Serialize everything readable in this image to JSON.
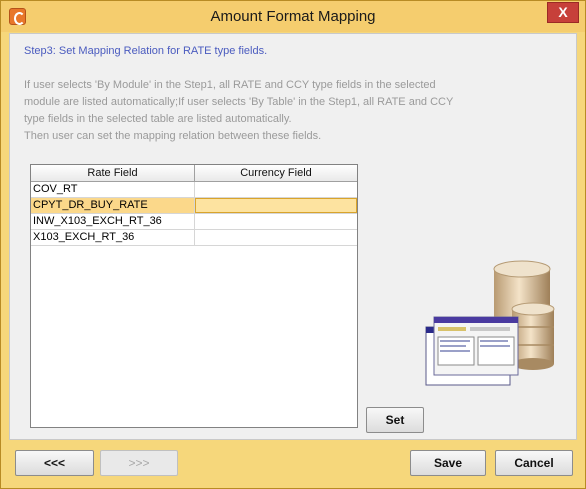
{
  "window": {
    "title": "Amount Format Mapping",
    "close_label": "X"
  },
  "step": {
    "title": "Step3: Set Mapping Relation for RATE type fields.",
    "description_lines": [
      "If user selects 'By Module' in the Step1, all RATE and CCY type fields in the selected",
      "module are listed automatically;If user selects 'By Table' in the Step1, all RATE and CCY",
      "type fields in the selected table are listed automatically.",
      "Then user can set the mapping relation between these fields."
    ]
  },
  "table": {
    "columns": [
      "Rate Field",
      "Currency Field"
    ],
    "rows": [
      {
        "rate": "COV_RT",
        "currency": ""
      },
      {
        "rate": "CPYT_DR_BUY_RATE",
        "currency": ""
      },
      {
        "rate": "INW_X103_EXCH_RT_36",
        "currency": ""
      },
      {
        "rate": "X103_EXCH_RT_36",
        "currency": ""
      }
    ],
    "selected_row_index": 1
  },
  "buttons": {
    "set": "Set",
    "prev": "<<<",
    "next": ">>>",
    "save": "Save",
    "cancel": "Cancel"
  },
  "colors": {
    "frame": "#f5cd6e",
    "selected_row": "#fbd88a",
    "step_title": "#4a5bbf",
    "description": "#9a9a9a",
    "close_button": "#c7403a"
  },
  "icons": {
    "app": "app-logo-icon",
    "illustration": "database-illustration-icon"
  }
}
